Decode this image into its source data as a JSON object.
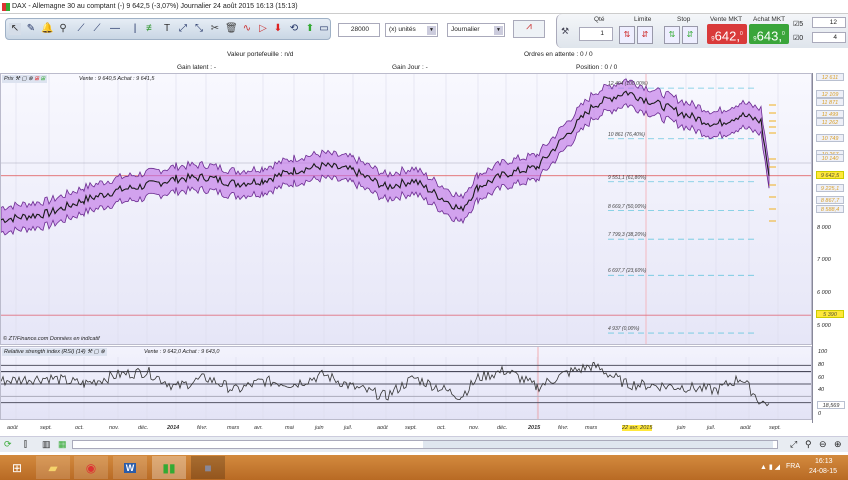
{
  "window": {
    "title": "DAX - Allemagne 30 au comptant (-)   9 642,5 (-3,07%)   Journalier  24 août 2015 16:13 (15:13)",
    "controls": [
      "_",
      "❐",
      "✕"
    ]
  },
  "toolbar": {
    "quantity": "28000",
    "unit": "(x) unités",
    "period": "Journalier"
  },
  "trade": {
    "qty_label": "Qté",
    "qty": "1",
    "limit_label": "Limite",
    "stop_label": "Stop",
    "sell_label": "Vente MKT",
    "sell_price": "642,",
    "sell_prefix": "9",
    "sell_suffix": "0",
    "buy_label": "Achat MKT",
    "buy_price": "643,",
    "buy_prefix": "9",
    "buy_suffix": "0",
    "check1": "5",
    "check2": "0",
    "spin1": "12",
    "spin2": "4"
  },
  "info": {
    "portfolio": "Valeur portefeuille : n/d",
    "pending": "Ordres en attente : 0 / 0",
    "latent": "Gain latent : -",
    "day": "Gain Jour : -",
    "position": "Position : 0 / 0"
  },
  "chart": {
    "header": "Prix",
    "quote": "Vente : 9 640,5  Achat : 9 641,5",
    "footer": "© ZT/Finance.com  Données en indicatif",
    "fib": [
      {
        "label": "12 404 (100,00%)",
        "v": 12404
      },
      {
        "label": "10 861 (76,40%)",
        "v": 10861
      },
      {
        "label": "9 551,1 (61,80%)",
        "v": 9551
      },
      {
        "label": "8 669,7 (50,00%)",
        "v": 8670
      },
      {
        "label": "7 799,3 (38,20%)",
        "v": 7799
      },
      {
        "label": "6 697,7 (23,60%)",
        "v": 6698
      },
      {
        "label": "4 937 (0,00%)",
        "v": 4937
      }
    ],
    "tags": [
      {
        "t": "12 611",
        "v": 12611
      },
      {
        "t": "12 109",
        "v": 12109
      },
      {
        "t": "11 871",
        "v": 11871
      },
      {
        "t": "11 499",
        "v": 11499
      },
      {
        "t": "11 262",
        "v": 11262
      },
      {
        "t": "10 749",
        "v": 10749
      },
      {
        "t": "10 267",
        "v": 10267
      },
      {
        "t": "10 140",
        "v": 10140
      },
      {
        "t": "9 642,5",
        "v": 9642.5,
        "hl": true
      },
      {
        "t": "9 225,1",
        "v": 9225
      },
      {
        "t": "8 867,7",
        "v": 8868
      },
      {
        "t": "8 588,4",
        "v": 8588
      },
      {
        "t": "5 390",
        "v": 5390,
        "hl": true
      }
    ],
    "ticks": [
      {
        "t": "8 000",
        "v": 8000
      },
      {
        "t": "7 000",
        "v": 7000
      },
      {
        "t": "6 000",
        "v": 6000
      },
      {
        "t": "5 000",
        "v": 5000
      }
    ]
  },
  "rsi": {
    "header": "Relative strength index (RSI) (14)",
    "quote": "Vente : 9 642,0  Achat : 9 643,0",
    "value": "18,569",
    "ticks": [
      "100",
      "80",
      "60",
      "40",
      "0"
    ]
  },
  "timeaxis": [
    "août",
    "sept.",
    "oct.",
    "nov.",
    "déc.",
    "2014",
    "févr.",
    "mars",
    "avr.",
    "mai",
    "juin",
    "juil.",
    "août",
    "sept.",
    "oct.",
    "nov.",
    "déc.",
    "2015",
    "févr.",
    "mars",
    "22 avr. 2015",
    "juin",
    "juil.",
    "août",
    "sept."
  ],
  "chart_data": {
    "type": "line",
    "title": "DAX daily",
    "x": [
      "2013-08",
      "2013-09",
      "2013-10",
      "2013-11",
      "2013-12",
      "2014-01",
      "2014-02",
      "2014-03",
      "2014-04",
      "2014-05",
      "2014-06",
      "2014-07",
      "2014-08",
      "2014-09",
      "2014-10",
      "2014-11",
      "2014-12",
      "2015-01",
      "2015-02",
      "2015-03",
      "2015-04",
      "2015-05",
      "2015-06",
      "2015-07",
      "2015-08",
      "2015-08-24"
    ],
    "values": [
      8300,
      8500,
      8900,
      9200,
      9350,
      9550,
      9600,
      9400,
      9500,
      9800,
      9950,
      9800,
      9300,
      9500,
      8600,
      9300,
      9700,
      9900,
      10900,
      11800,
      12200,
      11500,
      11200,
      11500,
      11300,
      9642
    ],
    "rsi": [
      55,
      60,
      50,
      65,
      70,
      45,
      60,
      40,
      55,
      50,
      65,
      45,
      30,
      60,
      30,
      60,
      72,
      45,
      68,
      80,
      50,
      45,
      40,
      60,
      20,
      18.6
    ]
  },
  "taskbar": {
    "lang": "FRA",
    "time": "16:13",
    "date": "24-08-15"
  }
}
